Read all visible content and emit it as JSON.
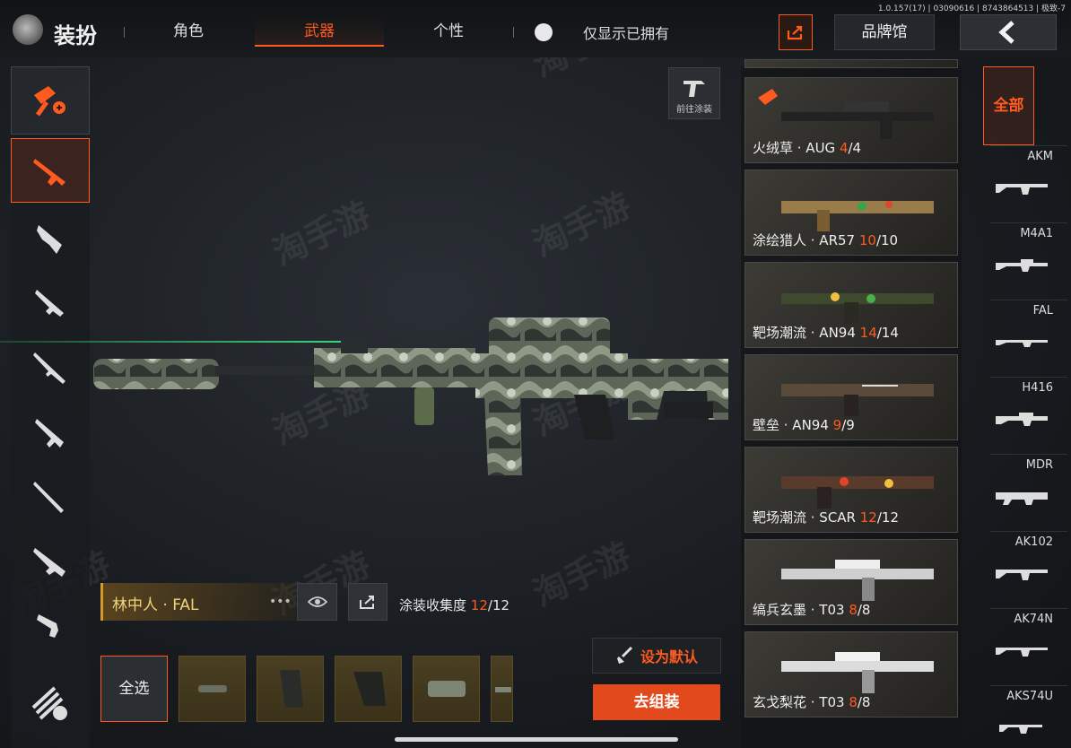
{
  "version": "1.0.157(17) | 03090616 | 8743864513 | 极致-7",
  "header": {
    "title": "装扮",
    "tabs": [
      {
        "label": "角色",
        "active": false
      },
      {
        "label": "武器",
        "active": true
      },
      {
        "label": "个性",
        "active": false
      }
    ],
    "toggle_label": "仅显示已拥有",
    "brand_hall": "品牌馆"
  },
  "left_sidebar": {
    "items": [
      "paint-tool-icon",
      "assault-rifle-icon",
      "smg-icon",
      "shotgun-icon",
      "sniper-rifle-icon",
      "dmr-icon",
      "bolt-rifle-icon",
      "lmg-icon",
      "pistol-icon",
      "melee-icon"
    ]
  },
  "center": {
    "goto_paint_label": "前往涂装",
    "skin_name": "林中人 · FAL",
    "collection_label": "涂装收集度",
    "collection_current": "12",
    "collection_total": "/12",
    "select_all": "全选",
    "set_default": "设为默认",
    "assemble": "去组装",
    "parts": [
      "muzzle",
      "grip",
      "foregrip",
      "scope",
      "stock"
    ]
  },
  "skins": [
    {
      "name": "火绒草 · AUG ",
      "cur": "4",
      "total": "/4"
    },
    {
      "name": "涂绘猎人 · AR57 ",
      "cur": "10",
      "total": "/10"
    },
    {
      "name": "靶场潮流 · AN94 ",
      "cur": "14",
      "total": "/14"
    },
    {
      "name": "壁垒 · AN94 ",
      "cur": "9",
      "total": "/9"
    },
    {
      "name": "靶场潮流 · SCAR ",
      "cur": "12",
      "total": "/12"
    },
    {
      "name": "缟兵玄墨 · T03 ",
      "cur": "8",
      "total": "/8"
    },
    {
      "name": "玄戈梨花 · T03 ",
      "cur": "8",
      "total": "/8"
    }
  ],
  "weapon_filter": {
    "all_label": "全部",
    "weapons": [
      "AKM",
      "M4A1",
      "FAL",
      "H416",
      "MDR",
      "AK102",
      "AK74N",
      "AKS74U"
    ]
  },
  "watermark": "淘手游",
  "colors": {
    "accent": "#ff5a1f",
    "gold": "#d39a2a"
  }
}
